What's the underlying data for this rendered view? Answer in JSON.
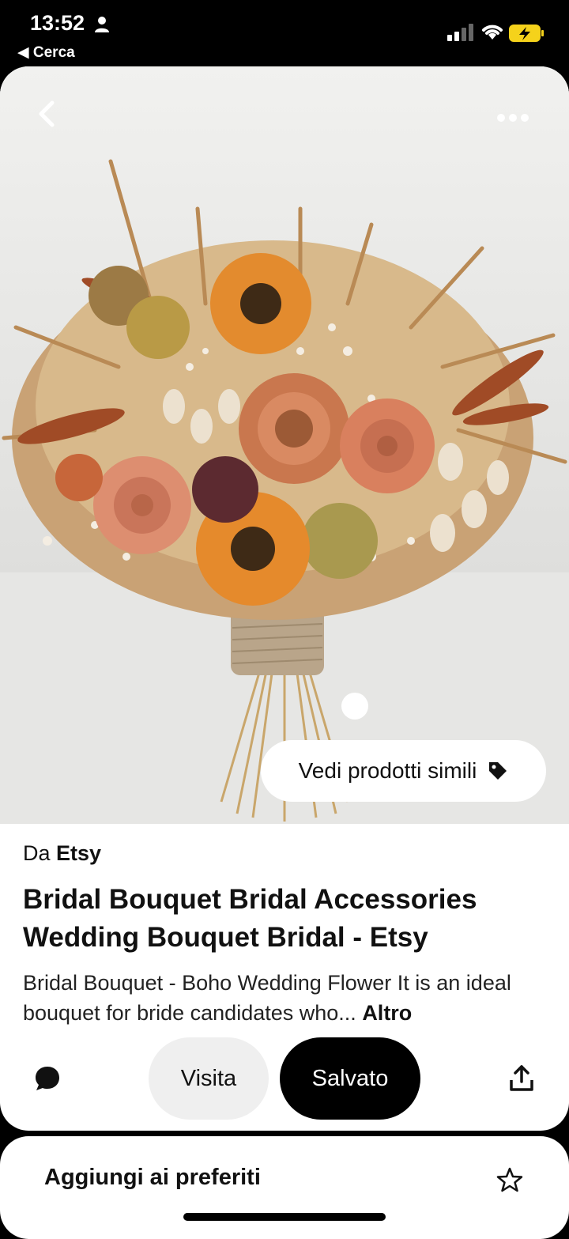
{
  "status_bar": {
    "time": "13:52",
    "back_label": "◀ Cerca",
    "icons": [
      "person-icon",
      "signal-icon",
      "wifi-icon",
      "battery-charging-icon"
    ]
  },
  "pin": {
    "image_alt": "Dried flower bridal bouquet",
    "similar_products_label": "Vedi prodotti simili",
    "source_prefix": "Da",
    "source_name": "Etsy",
    "title": "Bridal Bouquet Bridal Accessories Wedding Bouquet Bridal - Etsy",
    "description": "Bridal Bouquet - Boho Wedding Flower It is an ideal bouquet for bride candidates who...",
    "more_label": "Altro"
  },
  "actions": {
    "visit_label": "Visita",
    "saved_label": "Salvato"
  },
  "favorites": {
    "label": "Aggiungi ai preferiti"
  },
  "colors": {
    "saved_bg": "#000000",
    "visit_bg": "#efefef",
    "battery": "#f5d21b"
  }
}
